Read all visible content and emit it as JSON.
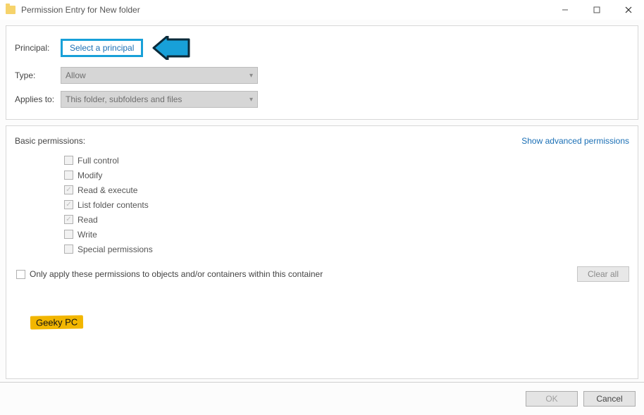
{
  "window": {
    "title": "Permission Entry for New folder"
  },
  "labels": {
    "principal": "Principal:",
    "type": "Type:",
    "applies_to": "Applies to:",
    "basic_permissions": "Basic permissions:",
    "show_advanced": "Show advanced permissions",
    "only_apply": "Only apply these permissions to objects and/or containers within this container",
    "clear_all": "Clear all",
    "ok": "OK",
    "cancel": "Cancel"
  },
  "principal": {
    "select_link": "Select a principal"
  },
  "type": {
    "value": "Allow"
  },
  "applies_to": {
    "value": "This folder, subfolders and files"
  },
  "permissions": [
    {
      "label": "Full control",
      "checked": false
    },
    {
      "label": "Modify",
      "checked": false
    },
    {
      "label": "Read & execute",
      "checked": true
    },
    {
      "label": "List folder contents",
      "checked": true
    },
    {
      "label": "Read",
      "checked": true
    },
    {
      "label": "Write",
      "checked": false
    },
    {
      "label": "Special permissions",
      "checked": false
    }
  ],
  "only_apply_checked": false,
  "watermark": "Geeky PC"
}
